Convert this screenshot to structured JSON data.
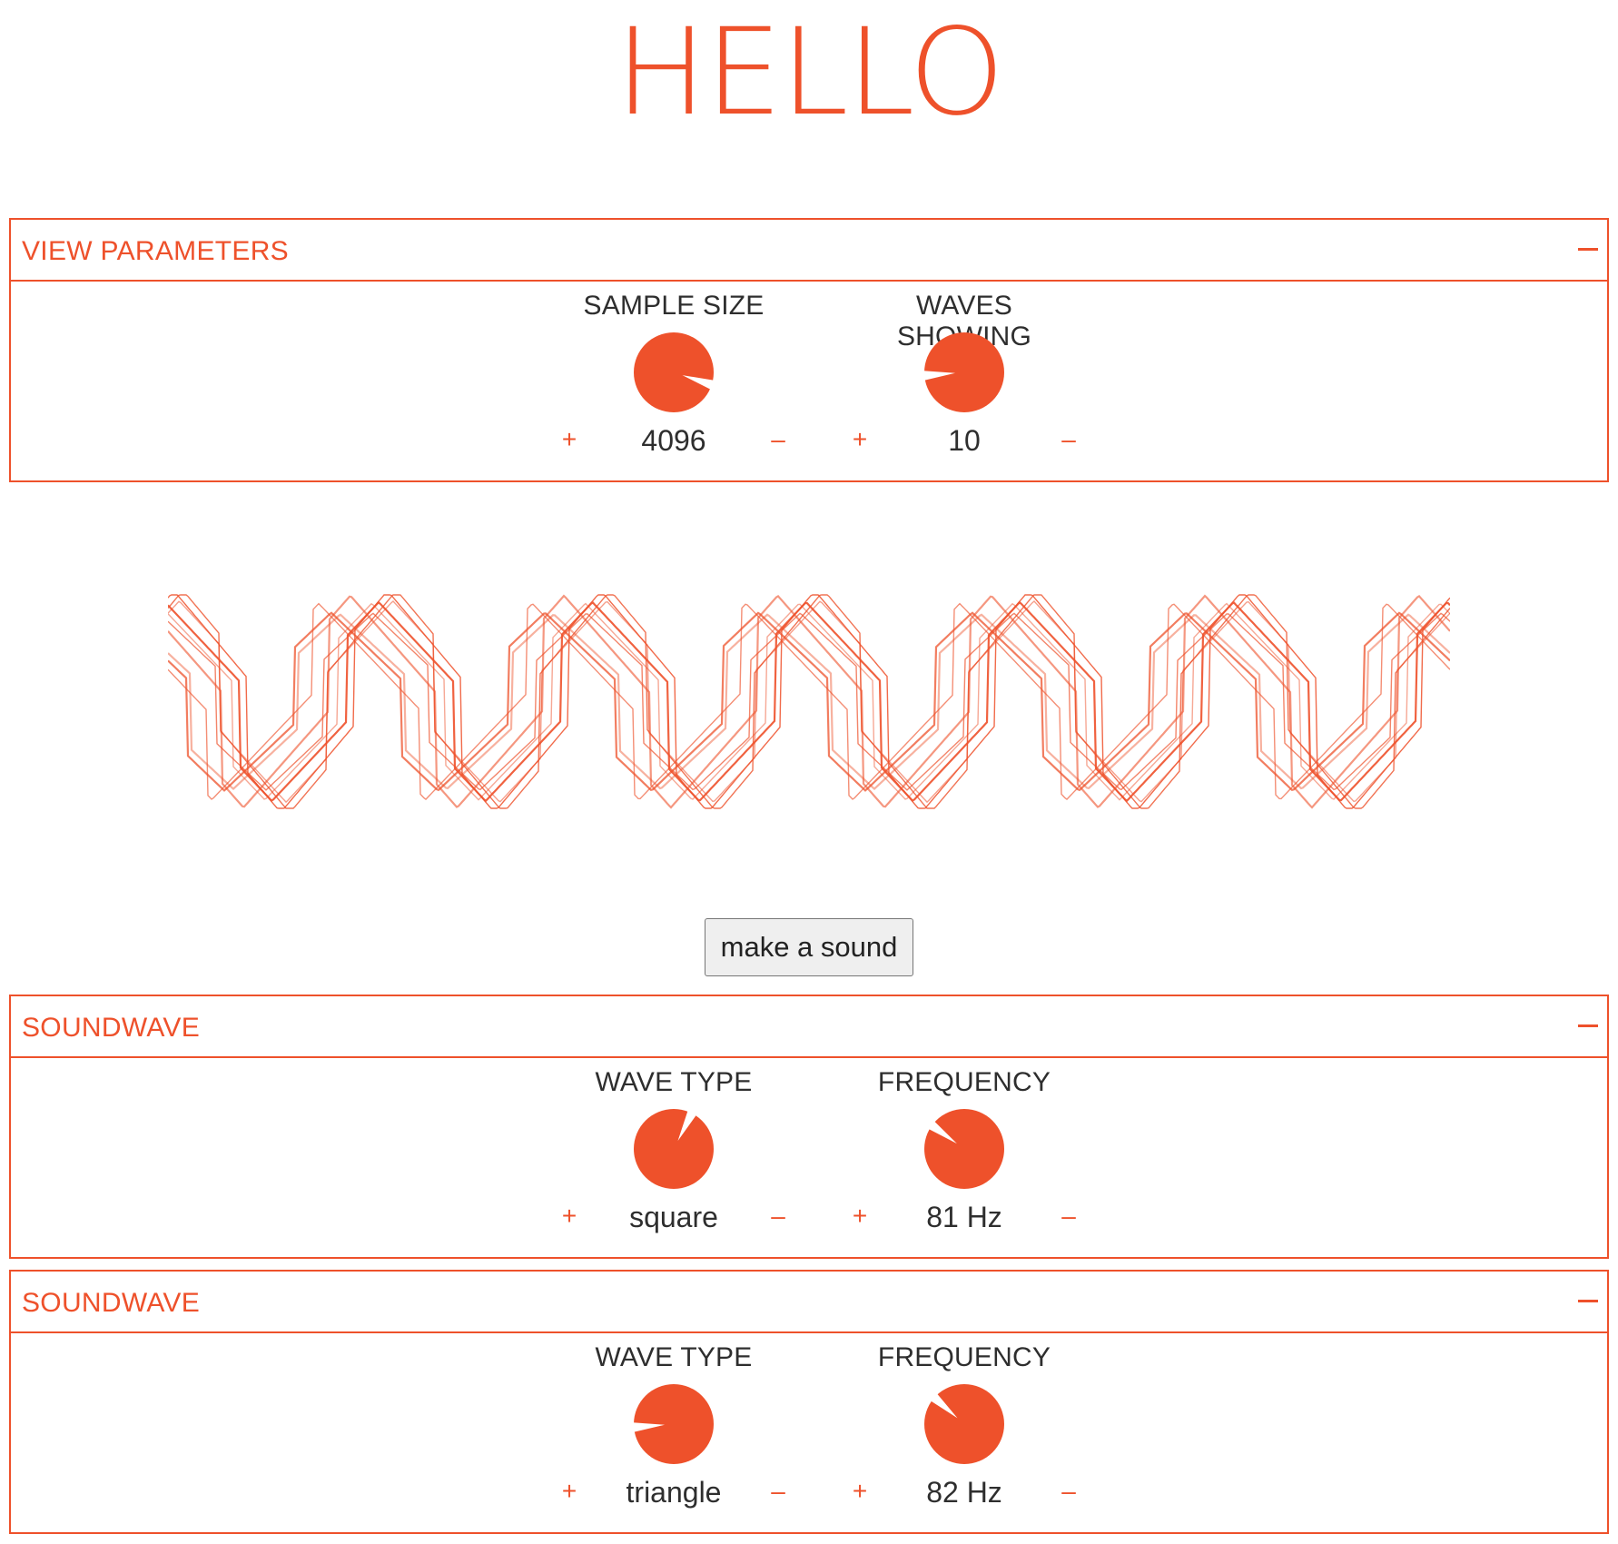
{
  "page": {
    "title": "HELLO"
  },
  "accent_color": "#ee512b",
  "view_parameters": {
    "title": "VIEW PARAMETERS",
    "collapse_icon": "minus-icon",
    "knobs": [
      {
        "label": "SAMPLE SIZE",
        "value": "4096",
        "plus": "+",
        "minus": "–",
        "level": 0.9
      },
      {
        "label": "WAVES SHOWING",
        "value": "10",
        "plus": "+",
        "minus": "–",
        "level": 0.15
      }
    ]
  },
  "make_sound_button": "make a sound",
  "soundwaves": [
    {
      "title": "SOUNDWAVE",
      "knobs": [
        {
          "label": "WAVE TYPE",
          "value": "square",
          "plus": "+",
          "minus": "–",
          "level": 0.6
        },
        {
          "label": "FREQUENCY",
          "value": "81 Hz",
          "plus": "+",
          "minus": "–",
          "level": 0.3
        }
      ]
    },
    {
      "title": "SOUNDWAVE",
      "knobs": [
        {
          "label": "WAVE TYPE",
          "value": "triangle",
          "plus": "+",
          "minus": "–",
          "level": 0.15
        },
        {
          "label": "FREQUENCY",
          "value": "82 Hz",
          "plus": "+",
          "minus": "–",
          "level": 0.32
        }
      ]
    }
  ],
  "waveform": {
    "waves": [
      "square-81Hz",
      "triangle-82Hz"
    ],
    "showing": 10
  }
}
